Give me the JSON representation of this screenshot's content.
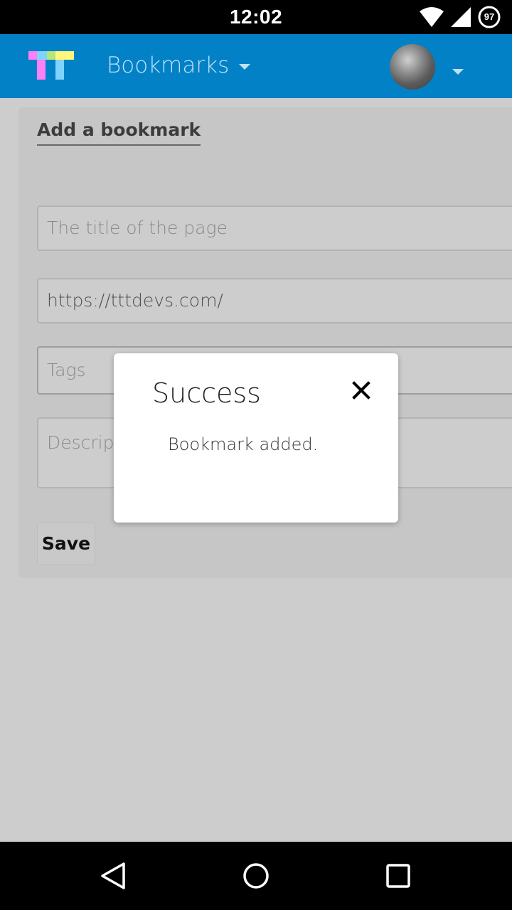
{
  "status_bar": {
    "time": "12:02",
    "battery_level": "97",
    "icons": [
      "wifi-icon",
      "signal-icon",
      "battery-icon"
    ]
  },
  "app_bar": {
    "nav_title": "Bookmarks",
    "logo_colors": [
      "#ff7ff6",
      "#7fd4ff",
      "#b7e67a",
      "#fff67a"
    ],
    "background_color": "#0281c7"
  },
  "form": {
    "heading": "Add a bookmark",
    "title_placeholder": "The title of the page",
    "url_value": "https://tttdevs.com/",
    "tags_placeholder": "Tags",
    "description_placeholder": "Descript",
    "save_label": "Save"
  },
  "dialog": {
    "title": "Success",
    "message": "Bookmark added."
  },
  "nav_bar": {
    "buttons": [
      "back-icon",
      "home-icon",
      "recents-icon"
    ]
  }
}
